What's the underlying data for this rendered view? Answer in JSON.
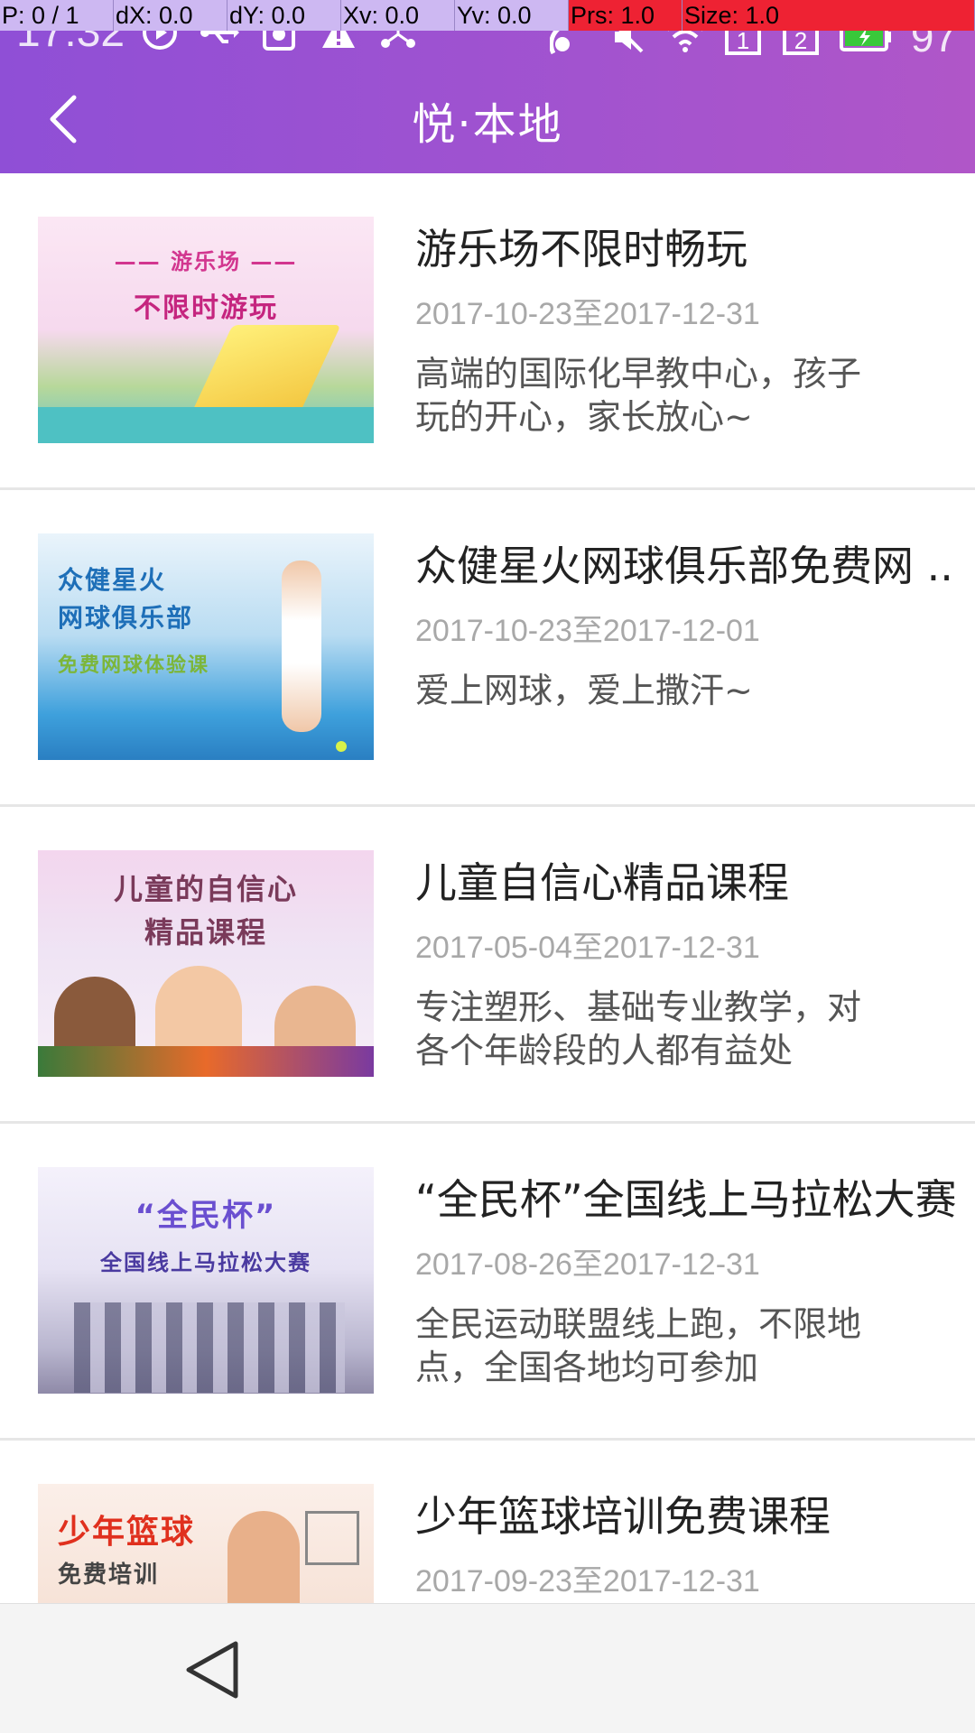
{
  "debug": {
    "p": "P: 0 / 1",
    "dx": "dX: 0.0",
    "dy": "dY: 0.0",
    "xv": "Xv: 0.0",
    "yv": "Yv: 0.0",
    "prs": "Prs: 1.0",
    "size": "Size: 1.0"
  },
  "status": {
    "time": "17:32",
    "battery": "97",
    "left_icons": [
      "play-icon",
      "usb-icon",
      "storage-icon",
      "warning-icon",
      "share-icon"
    ],
    "right_icons": [
      "hotspot-icon",
      "mute-icon",
      "wifi-icon",
      "sim1-icon",
      "sim2-icon",
      "battery-icon"
    ]
  },
  "header": {
    "title": "悦·本地",
    "back_icon": "chevron-left-icon"
  },
  "items": [
    {
      "title": "游乐场不限时畅玩",
      "date": "2017-10-23至2017-12-31",
      "desc": "高端的国际化早教中心，孩子玩的开心，家长放心~",
      "thumb_text_1": "—— 游乐场 ——",
      "thumb_text_2": "不限时游玩"
    },
    {
      "title": "众健星火网球俱乐部免费网 ..",
      "date": "2017-10-23至2017-12-01",
      "desc": "爱上网球，爱上撒汗~",
      "thumb_text_1": "众健星火",
      "thumb_text_2": "网球俱乐部",
      "thumb_text_3": "免费网球体验课"
    },
    {
      "title": "儿童自信心精品课程",
      "date": "2017-05-04至2017-12-31",
      "desc": "专注塑形、基础专业教学，对各个年龄段的人都有益处",
      "thumb_text_1": "儿童的自信心",
      "thumb_text_2": "精品课程"
    },
    {
      "title": "“全民杯”全国线上马拉松大赛",
      "date": "2017-08-26至2017-12-31",
      "desc": "全民运动联盟线上跑，不限地点，全国各地均可参加",
      "thumb_text_1": "“全民杯”",
      "thumb_text_2": "全国线上马拉松大赛"
    },
    {
      "title": "少年篮球培训免费课程",
      "date": "2017-09-23至2017-12-31",
      "desc": "",
      "thumb_text_1": "少年篮球",
      "thumb_text_2": "免费培训"
    }
  ],
  "nav": {
    "back_icon": "triangle-back-icon"
  }
}
